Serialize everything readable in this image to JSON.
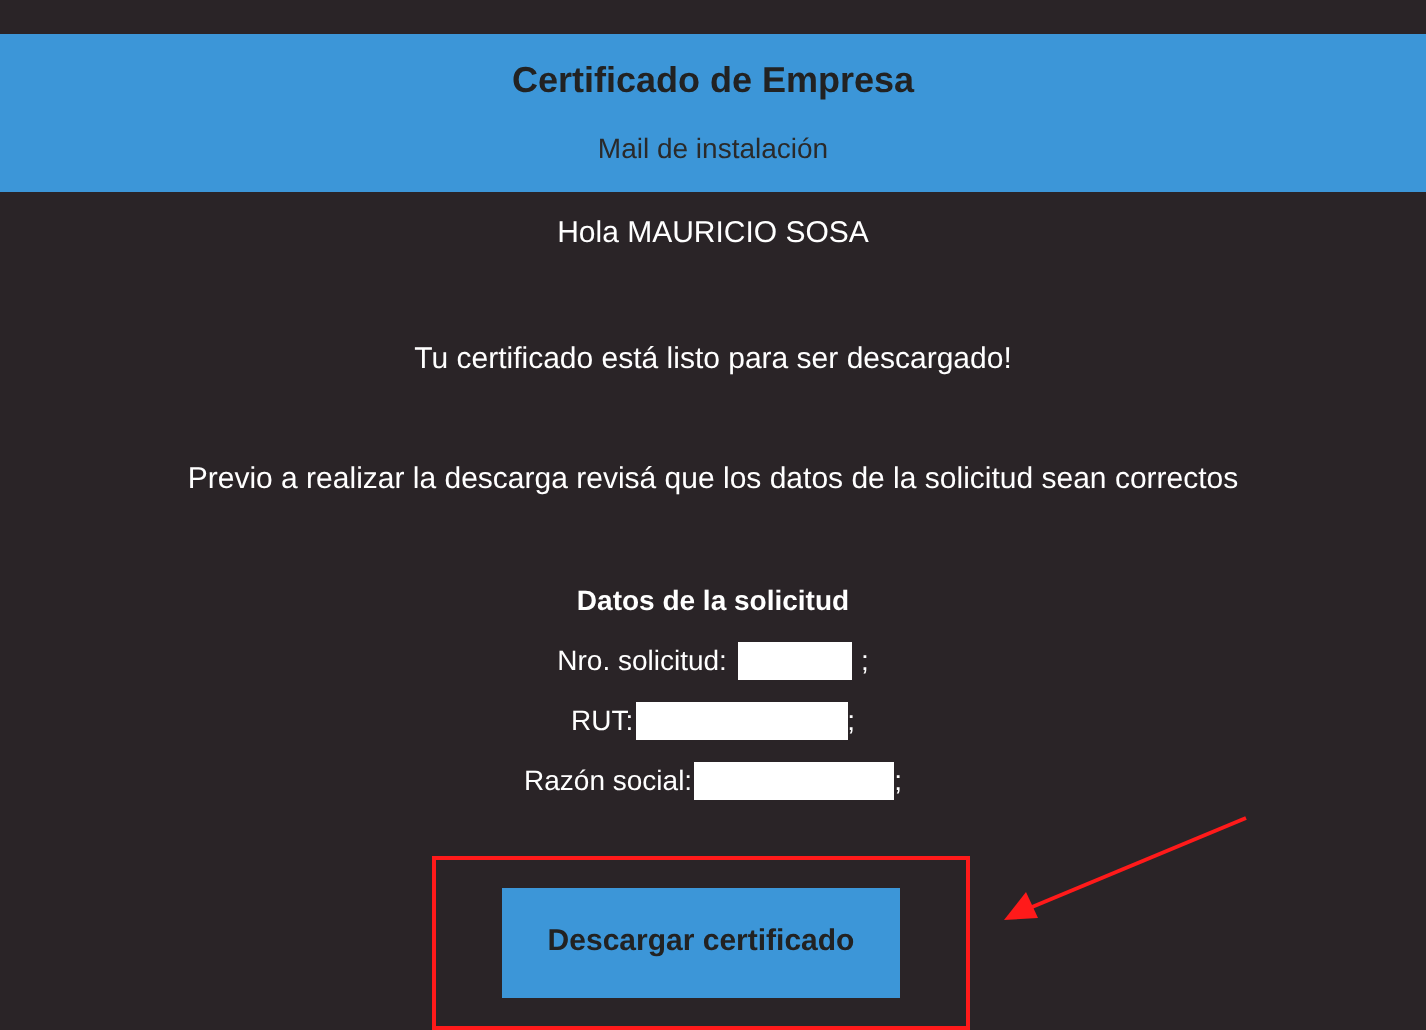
{
  "header": {
    "title": "Certificado de Empresa",
    "subtitle": "Mail de instalación"
  },
  "greeting": "Hola MAURICIO SOSA",
  "messages": [
    "Tu certificado está listo para ser descargado!",
    "Previo a realizar la descarga revisá que los datos de la solicitud sean correctos"
  ],
  "details": {
    "title": "Datos de la solicitud",
    "rows": [
      {
        "label": "Nro. solicitud:",
        "redacted": true,
        "suffix": ";"
      },
      {
        "label": "RUT:",
        "redacted": true,
        "suffix": ";"
      },
      {
        "label": "Razón social:",
        "redacted": true,
        "suffix": ";"
      }
    ]
  },
  "download_button": {
    "label": "Descargar certificado",
    "highlighted": true
  },
  "annotation_arrow": true
}
